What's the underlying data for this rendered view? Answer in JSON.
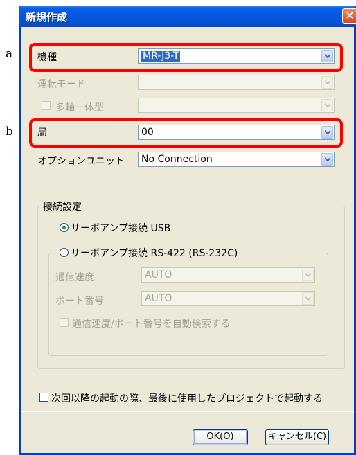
{
  "side_labels": {
    "a": "a",
    "b": "b"
  },
  "window": {
    "title": "新規作成",
    "close_glyph": "✕"
  },
  "fields": {
    "model": {
      "label": "機種",
      "value": "MR-J3-T"
    },
    "operation_mode": {
      "label": "運転モード",
      "value": ""
    },
    "multi_axis": {
      "label": "多軸一体型",
      "checked": false
    },
    "station": {
      "label": "局",
      "value": "00"
    },
    "option_unit": {
      "label": "オプションユニット",
      "value": "No Connection"
    }
  },
  "connection": {
    "group_label": "接続設定",
    "usb_label": "サーボアンプ接続 USB",
    "usb_selected": true,
    "rs422_label": "サーボアンプ接続 RS-422 (RS-232C)",
    "rs422_selected": false,
    "baud_label": "通信速度",
    "baud_value": "AUTO",
    "port_label": "ポート番号",
    "port_value": "AUTO",
    "autosearch_label": "通信速度/ポート番号を自動検索する",
    "autosearch_checked": false
  },
  "startup_checkbox": {
    "label": "次回以降の起動の際、最後に使用したプロジェクトで起動する",
    "checked": false
  },
  "buttons": {
    "ok": "OK(O)",
    "cancel": "キャンセル(C)"
  },
  "colors": {
    "highlight_border": "#ff0000",
    "title_bar": "#0658e0",
    "dialog_bg": "#ece9d8"
  }
}
